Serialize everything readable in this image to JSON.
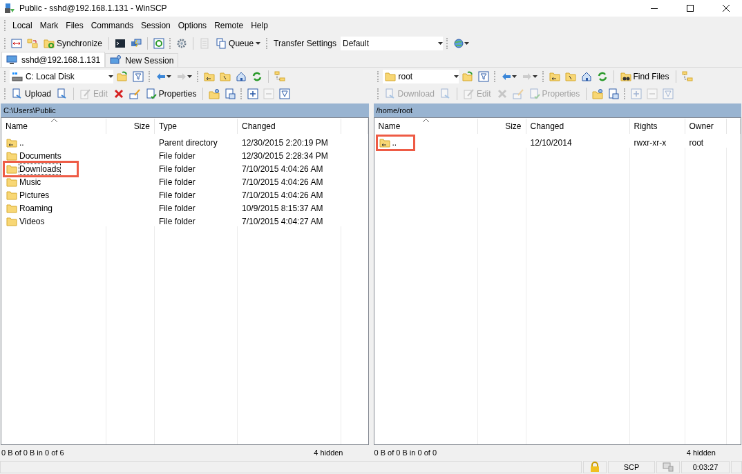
{
  "window": {
    "title": "Public - sshd@192.168.1.131 - WinSCP"
  },
  "menu": [
    "Local",
    "Mark",
    "Files",
    "Commands",
    "Session",
    "Options",
    "Remote",
    "Help"
  ],
  "toolbar": {
    "synchronize": "Synchronize",
    "queue": "Queue",
    "transfer_label": "Transfer Settings",
    "transfer_value": "Default"
  },
  "session_tabs": [
    {
      "label": "sshd@192.168.1.131",
      "selected": true
    },
    {
      "label": "New Session",
      "selected": false
    }
  ],
  "panels": [
    {
      "location": "C: Local Disk",
      "transfer": {
        "label": "Upload",
        "disabled": false
      },
      "edit": {
        "label": "Edit",
        "disabled": true
      },
      "properties": {
        "label": "Properties",
        "disabled": false
      },
      "path": "C:\\Users\\Public",
      "columns": [
        {
          "label": "Name",
          "sorted": true
        },
        {
          "label": "Size",
          "sorted": false
        },
        {
          "label": "Type",
          "sorted": false
        },
        {
          "label": "Changed",
          "sorted": false
        }
      ],
      "rows": [
        {
          "kind": "parent",
          "highlighted": false,
          "cells": [
            "..",
            "",
            "Parent directory",
            "12/30/2015  2:20:19 PM"
          ]
        },
        {
          "kind": "folder",
          "highlighted": false,
          "cells": [
            "Documents",
            "",
            "File folder",
            "12/30/2015  2:28:34 PM"
          ]
        },
        {
          "kind": "folder",
          "highlighted": true,
          "cells": [
            "Downloads",
            "",
            "File folder",
            "7/10/2015  4:04:26 AM"
          ]
        },
        {
          "kind": "folder",
          "highlighted": false,
          "cells": [
            "Music",
            "",
            "File folder",
            "7/10/2015  4:04:26 AM"
          ]
        },
        {
          "kind": "folder",
          "highlighted": false,
          "cells": [
            "Pictures",
            "",
            "File folder",
            "7/10/2015  4:04:26 AM"
          ]
        },
        {
          "kind": "folder",
          "highlighted": false,
          "cells": [
            "Roaming",
            "",
            "File folder",
            "10/9/2015  8:15:37 AM"
          ]
        },
        {
          "kind": "folder",
          "highlighted": false,
          "cells": [
            "Videos",
            "",
            "File folder",
            "7/10/2015  4:04:27 AM"
          ]
        }
      ],
      "status": "0 B of 0 B in 0 of 6",
      "hidden": "4 hidden"
    },
    {
      "location": "root",
      "transfer": {
        "label": "Download",
        "disabled": true
      },
      "edit": {
        "label": "Edit",
        "disabled": true
      },
      "properties": {
        "label": "Properties",
        "disabled": true
      },
      "find": "Find Files",
      "path": "/home/root",
      "columns": [
        {
          "label": "Name",
          "sorted": true
        },
        {
          "label": "Size",
          "sorted": false
        },
        {
          "label": "Changed",
          "sorted": false
        },
        {
          "label": "Rights",
          "sorted": false
        },
        {
          "label": "Owner",
          "sorted": false
        }
      ],
      "rows": [
        {
          "kind": "parent",
          "highlighted": true,
          "cells": [
            "..",
            "",
            "12/10/2014",
            "rwxr-xr-x",
            "root"
          ]
        }
      ],
      "status": "0 B of 0 B in 0 of 0",
      "hidden": "4 hidden"
    }
  ],
  "status_bar": {
    "protocol": "SCP",
    "time": "0:03:27"
  }
}
